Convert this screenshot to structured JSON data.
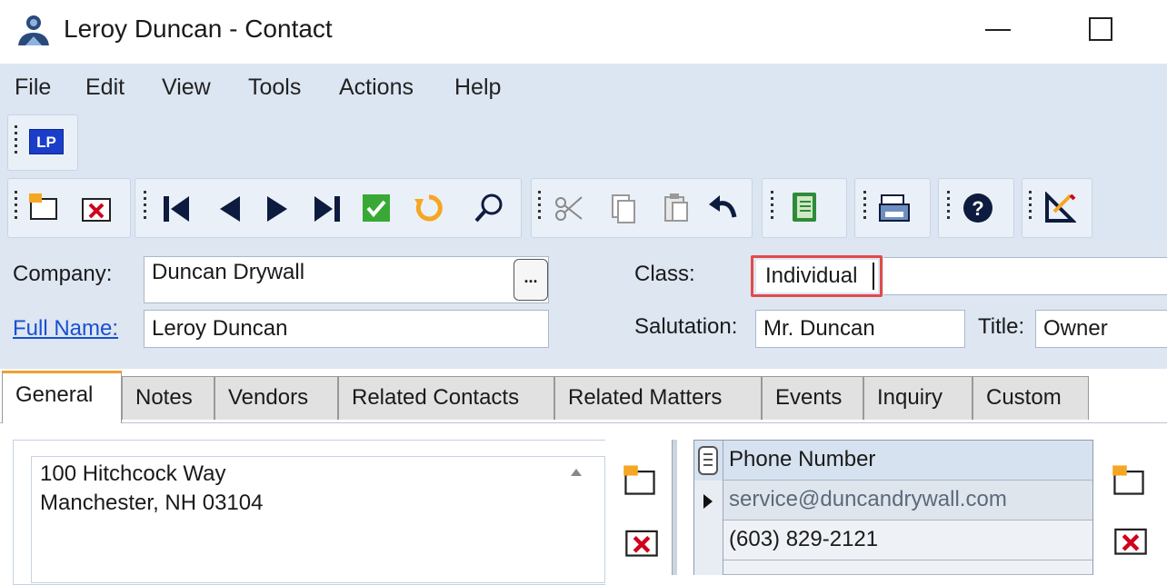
{
  "window": {
    "title": "Leroy Duncan - Contact"
  },
  "menu": [
    "File",
    "Edit",
    "View",
    "Tools",
    "Actions",
    "Help"
  ],
  "toolbar": {
    "lp_label": "LP"
  },
  "form": {
    "company_label": "Company:",
    "company_value": "Duncan Drywall",
    "ellipsis_label": "...",
    "fullname_label": "Full Name:",
    "fullname_value": "Leroy Duncan",
    "class_label": "Class:",
    "class_value": "Individual",
    "salutation_label": "Salutation:",
    "salutation_value": "Mr. Duncan",
    "title_label": "Title:",
    "title_value": "Owner"
  },
  "tabs": [
    "General",
    "Notes",
    "Vendors",
    "Related Contacts",
    "Related Matters",
    "Events",
    "Inquiry",
    "Custom"
  ],
  "address": {
    "line1": "100 Hitchcock Way",
    "line2": "Manchester, NH  03104"
  },
  "phones": {
    "header": "Phone Number",
    "rows": [
      "service@duncandrywall.com",
      "(603) 829-2121"
    ]
  },
  "colors": {
    "accent_tab": "#f0a030",
    "highlight_box": "#e24a4a",
    "toolbar_bg": "#dce6f2",
    "link": "#1a4fd0"
  }
}
